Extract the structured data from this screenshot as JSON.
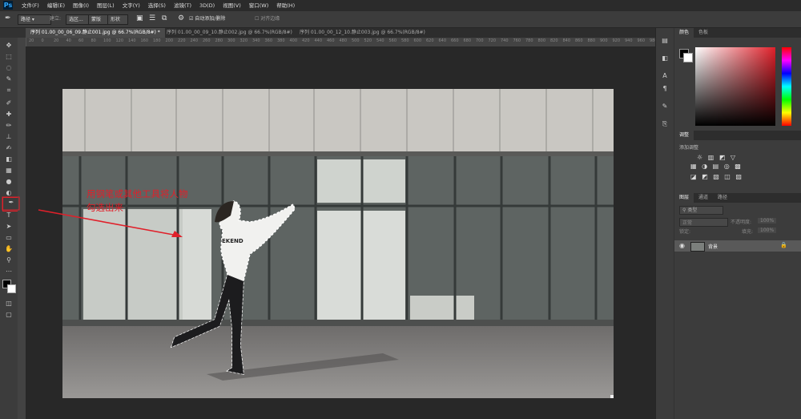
{
  "menubar": {
    "logo": "Ps",
    "items": [
      "文件(F)",
      "编辑(E)",
      "图像(I)",
      "图层(L)",
      "文字(Y)",
      "选择(S)",
      "滤镜(T)",
      "3D(D)",
      "视图(V)",
      "窗口(W)",
      "帮助(H)"
    ]
  },
  "options": {
    "mode": "路径",
    "make": "建立:",
    "select_btn": "选区...",
    "mask_btn": "蒙版",
    "shape_btn": "形状",
    "auto_add": "自动添加/删除",
    "align_edges": "对齐边缘"
  },
  "tabs": [
    {
      "label": "序列 01.00_00_06_09.静止001.jpg @ 66.7%(RGB/8#) *"
    },
    {
      "label": "序列 01.00_00_09_10.静止002.jpg @ 66.7%(RGB/8#)"
    },
    {
      "label": "序列 01.00_00_12_10.静止003.jpg @ 66.7%(RGB/8#)"
    }
  ],
  "annotation": {
    "line1": "用钢笔或其他工具将人物",
    "line2": "勾选出来"
  },
  "ruler_ticks": [
    "20",
    "0",
    "20",
    "40",
    "60",
    "80",
    "100",
    "120",
    "140",
    "160",
    "180",
    "200",
    "220",
    "240",
    "260",
    "280",
    "300",
    "320",
    "340",
    "360",
    "380",
    "400",
    "420",
    "440",
    "460",
    "480",
    "500",
    "520",
    "540",
    "560",
    "580",
    "600",
    "620",
    "640",
    "660",
    "680",
    "700",
    "720",
    "740",
    "760",
    "780",
    "800",
    "820",
    "840",
    "860",
    "880",
    "900",
    "920",
    "940",
    "960",
    "980"
  ],
  "color_panel": {
    "tab1": "颜色",
    "tab2": "色板"
  },
  "adjust_panel": {
    "tab": "调整",
    "add_label": "添加调整"
  },
  "layers_panel": {
    "tabs": [
      "图层",
      "通道",
      "路径"
    ],
    "kind": "类型",
    "blend": "正常",
    "opacity_label": "不透明度:",
    "opacity_value": "100%",
    "lock_label": "锁定:",
    "fill_label": "填充:",
    "fill_value": "100%",
    "layer_name": "背景"
  },
  "colors": {
    "accent_red": "#e0202a",
    "photo_sky": "#8a8e8c"
  }
}
